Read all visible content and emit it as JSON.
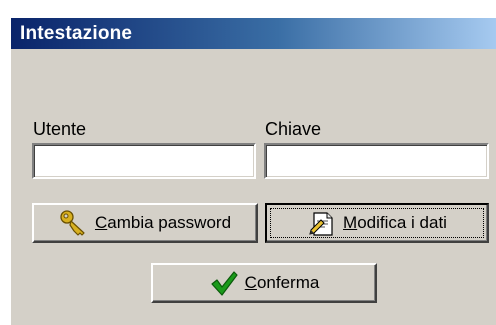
{
  "window": {
    "title": "Intestazione"
  },
  "form": {
    "user_label": "Utente",
    "user_value": "",
    "key_label": "Chiave",
    "key_value": ""
  },
  "buttons": {
    "change_password": {
      "mnemonic": "C",
      "rest": "ambia password",
      "icon": "key-icon"
    },
    "edit_data": {
      "mnemonic": "M",
      "rest": "odifica i dati",
      "icon": "edit-document-icon"
    },
    "confirm": {
      "mnemonic": "C",
      "rest": "onferma",
      "icon": "checkmark-icon"
    }
  },
  "colors": {
    "face": "#d4d0c8",
    "title_start": "#0a246a",
    "title_end": "#a6caf0",
    "check_green": "#1a9a1a",
    "key_gold": "#d8b020"
  }
}
